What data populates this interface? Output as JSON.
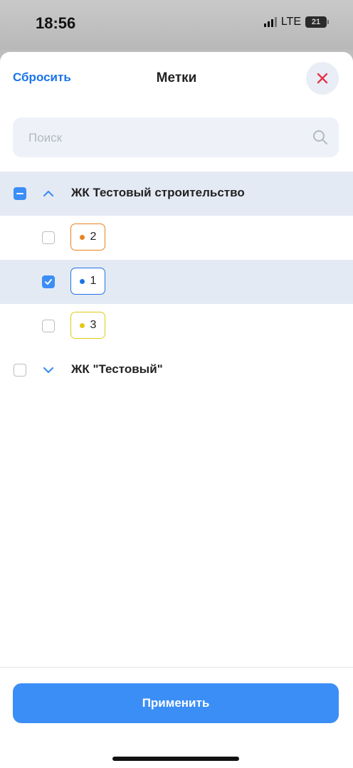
{
  "status_bar": {
    "time": "18:56",
    "network": "LTE",
    "battery": "21"
  },
  "header": {
    "reset_label": "Сбросить",
    "title": "Метки",
    "close_icon": "close-x-icon",
    "close_color": "#e5344d"
  },
  "search": {
    "placeholder": "Поиск",
    "value": "",
    "icon": "search-icon"
  },
  "groups": [
    {
      "label": "ЖК Тестовый строительство",
      "state": "indeterminate",
      "expanded": true,
      "tags": [
        {
          "label": "2",
          "checked": false,
          "color": "#e8821e"
        },
        {
          "label": "1",
          "checked": true,
          "color": "#1a73e8"
        },
        {
          "label": "3",
          "checked": false,
          "color": "#e3c916"
        }
      ]
    },
    {
      "label": "ЖК \"Тестовый\"",
      "state": "unchecked",
      "expanded": false,
      "tags": []
    }
  ],
  "footer": {
    "apply_label": "Применить"
  },
  "colors": {
    "accent": "#3b8ef6",
    "link": "#1a73e8",
    "selected_row": "#e4eaf3"
  }
}
